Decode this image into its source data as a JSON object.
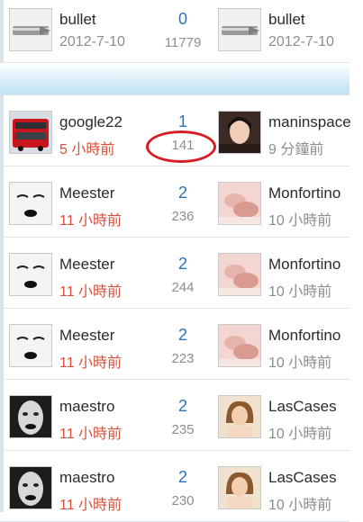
{
  "rows": [
    {
      "name": "bullet",
      "time": "2012-7-10",
      "replies": "0",
      "views": "11779",
      "last_name": "bullet",
      "last_time": "2012-7-10",
      "avatar": "bullet-icon",
      "last_avatar": "bullet-icon"
    },
    {
      "name": "google22",
      "time": "5 小時前",
      "replies": "1",
      "views": "141",
      "last_name": "maninspace",
      "last_time": "9 分鐘前",
      "avatar": "bus-icon",
      "last_avatar": "portrait-icon"
    },
    {
      "name": "Meester",
      "time": "11 小時前",
      "replies": "2",
      "views": "236",
      "last_name": "Monfortino",
      "last_time": "10 小時前",
      "avatar": "face-sketch-icon",
      "last_avatar": "pink-photo-icon"
    },
    {
      "name": "Meester",
      "time": "11 小時前",
      "replies": "2",
      "views": "244",
      "last_name": "Monfortino",
      "last_time": "10 小時前",
      "avatar": "face-sketch-icon",
      "last_avatar": "pink-photo-icon"
    },
    {
      "name": "Meester",
      "time": "11 小時前",
      "replies": "2",
      "views": "223",
      "last_name": "Monfortino",
      "last_time": "10 小時前",
      "avatar": "face-sketch-icon",
      "last_avatar": "pink-photo-icon"
    },
    {
      "name": "maestro",
      "time": "11 小時前",
      "replies": "2",
      "views": "235",
      "last_name": "LasCases",
      "last_time": "10 小時前",
      "avatar": "bw-face-icon",
      "last_avatar": "girl-photo-icon"
    },
    {
      "name": "maestro",
      "time": "11 小時前",
      "replies": "2",
      "views": "230",
      "last_name": "LasCases",
      "last_time": "10 小時前",
      "avatar": "bw-face-icon",
      "last_avatar": "girl-photo-icon"
    }
  ]
}
